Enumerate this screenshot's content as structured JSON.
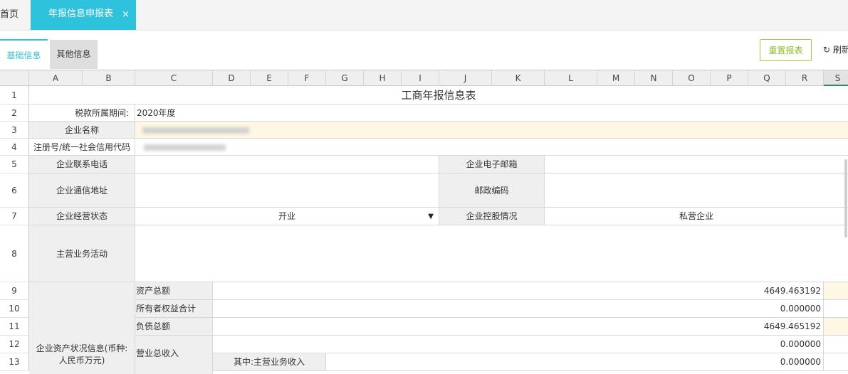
{
  "tabs": {
    "home": "首页",
    "active": "年报信息申报表",
    "active_close": "×"
  },
  "subtabs": {
    "basic": "基础信息",
    "other": "其他信息"
  },
  "toolbar": {
    "reset": "重置报表",
    "refresh_icon": "↻",
    "refresh": "刷新"
  },
  "columns": [
    "A",
    "B",
    "C",
    "D",
    "E",
    "F",
    "G",
    "H",
    "I",
    "J",
    "K",
    "L",
    "M",
    "N",
    "O",
    "P",
    "Q",
    "R",
    "S"
  ],
  "rows": [
    "1",
    "2",
    "3",
    "4",
    "5",
    "6",
    "7",
    "8",
    "9",
    "10",
    "11",
    "12",
    "13"
  ],
  "form": {
    "title": "工商年报信息表",
    "tax_period_label": "税款所属期间:",
    "tax_period_value": "2020年度",
    "company_name_label": "企业名称",
    "reg_no_label": "注册号/统一社会信用代码",
    "phone_label": "企业联系电话",
    "email_label": "企业电子邮箱",
    "address_label": "企业通信地址",
    "postcode_label": "邮政编码",
    "status_label": "企业经营状态",
    "status_value": "开业",
    "status_arrow": "▼",
    "holding_label": "企业控股情况",
    "holding_value": "私营企业",
    "main_business_label": "主营业务活动",
    "assets_group_label": "企业资产状况信息(币种:人民币万元)",
    "total_assets_label": "资产总额",
    "total_assets_value": "4649.463192",
    "equity_label": "所有者权益合计",
    "equity_value": "0.000000",
    "liabilities_label": "负债总额",
    "liabilities_value": "4649.465192",
    "revenue_label": "营业总收入",
    "revenue_value": "0.000000",
    "main_revenue_label": "其中:主营业务收入",
    "main_revenue_value": "0.000000"
  },
  "colors": {
    "accent": "#2fc2dd",
    "reset_border": "#a0cc45",
    "cream": "#fdf7e4",
    "label_bg": "#efefef"
  }
}
